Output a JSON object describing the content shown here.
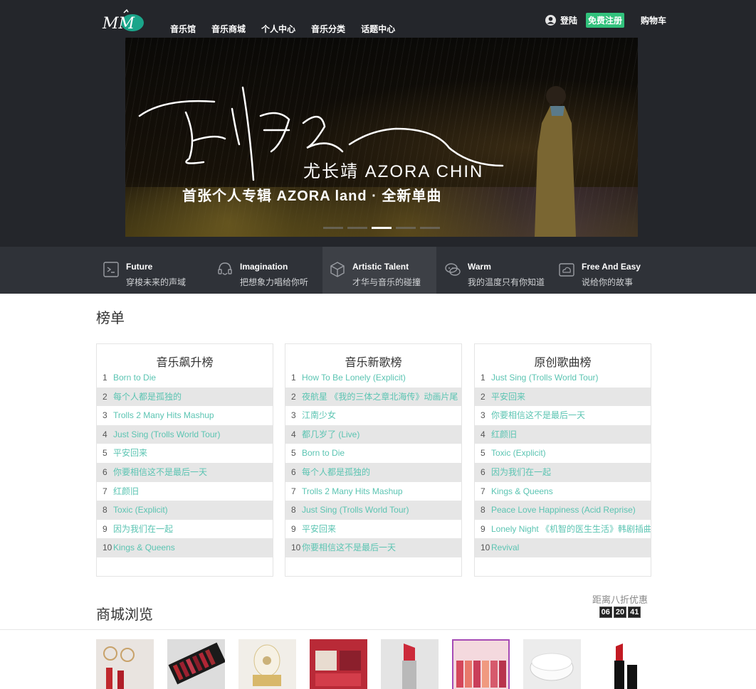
{
  "nav": {
    "items": [
      "音乐馆",
      "音乐商城",
      "个人中心",
      "音乐分类",
      "话题中心"
    ]
  },
  "user": {
    "login": "登陆",
    "register": "免费注册",
    "cart": "购物车"
  },
  "banner": {
    "artist": "尤长靖 AZORA CHIN",
    "album": "首张个人专辑 AZORA land · 全新单曲",
    "active_slide": 3,
    "slides": 5
  },
  "features": [
    {
      "title": "Future",
      "subtitle": "穿梭未来的声域",
      "icon": "terminal-icon"
    },
    {
      "title": "Imagination",
      "subtitle": "把想象力唱给你听",
      "icon": "headphone-face-icon"
    },
    {
      "title": "Artistic Talent",
      "subtitle": "才华与音乐的碰撞",
      "icon": "cube-icon"
    },
    {
      "title": "Warm",
      "subtitle": "我的温度只有你知道",
      "icon": "chat-bubbles-icon"
    },
    {
      "title": "Free And Easy",
      "subtitle": "说给你的故事",
      "icon": "cloud-box-icon"
    }
  ],
  "charts_section": {
    "title": "榜单",
    "lists": [
      {
        "title": "音乐飙升榜",
        "items": [
          "Born to Die",
          "每个人都是孤独的",
          "Trolls 2 Many Hits Mashup",
          "Just Sing (Trolls World Tour)",
          "平安回来",
          "你要相信这不是最后一天",
          "红颜旧",
          "Toxic (Explicit)",
          "因为我们在一起",
          "Kings & Queens"
        ]
      },
      {
        "title": "音乐新歌榜",
        "items": [
          "How To Be Lonely (Explicit)",
          "夜航星 《我的三体之章北海传》动画片尾",
          "江南少女",
          "都几岁了 (Live)",
          "Born to Die",
          "每个人都是孤独的",
          "Trolls 2 Many Hits Mashup",
          "Just Sing (Trolls World Tour)",
          "平安回来",
          "你要相信这不是最后一天"
        ]
      },
      {
        "title": "原创歌曲榜",
        "items": [
          "Just Sing (Trolls World Tour)",
          "平安回来",
          "你要相信这不是最后一天",
          "红颜旧",
          "Toxic (Explicit)",
          "因为我们在一起",
          "Kings & Queens",
          "Peace Love Happiness (Acid Reprise)",
          "Lonely Night 《机智的医生生活》韩剧插曲",
          "Revival"
        ]
      }
    ]
  },
  "shop": {
    "title": "商城浏览",
    "countdown_label": "距离八折优惠",
    "countdown": [
      "06",
      "20",
      "41"
    ],
    "products": [
      {
        "name": "lipstick-glasses"
      },
      {
        "name": "lipstick-set-black"
      },
      {
        "name": "music-box"
      },
      {
        "name": "lipstick-ad-red"
      },
      {
        "name": "lipstick-closeup"
      },
      {
        "name": "colourpop-lipsticks"
      },
      {
        "name": "white-compact"
      },
      {
        "name": "tom-ford-lipstick"
      }
    ]
  },
  "colors": {
    "header_bg": "#24262b",
    "features_bg": "#2f3238",
    "accent": "#31c27c",
    "song_link": "#5bc4b2",
    "row_stripe": "#e6e6e6"
  }
}
